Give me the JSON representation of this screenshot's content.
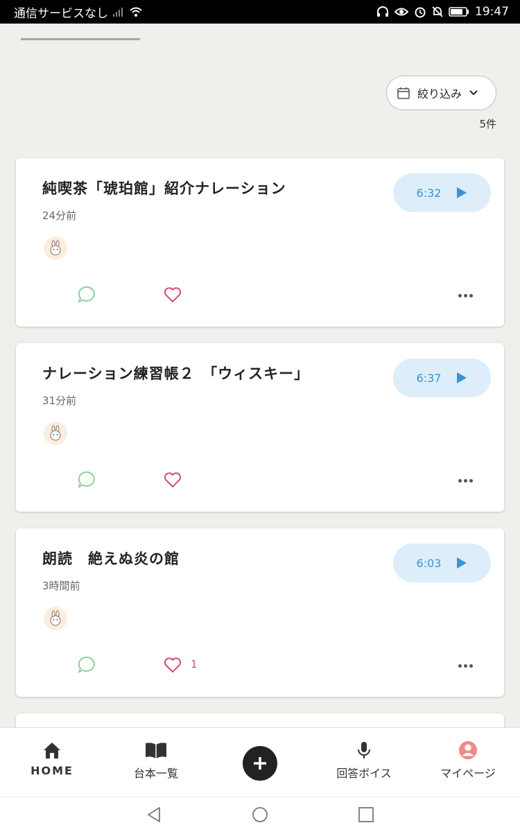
{
  "status": {
    "carrier": "通信サービスなし",
    "time": "19:47"
  },
  "filter": {
    "label": "絞り込み",
    "count": "5件"
  },
  "cards": [
    {
      "title": "純喫茶「琥珀館」紹介ナレーション",
      "time": "24分前",
      "duration": "6:32",
      "likes": ""
    },
    {
      "title": "ナレーション練習帳２　「ウィスキー」",
      "time": "31分前",
      "duration": "6:37",
      "likes": ""
    },
    {
      "title": "朗読　絶えぬ炎の館",
      "time": "3時間前",
      "duration": "6:03",
      "likes": "1"
    }
  ],
  "nav": {
    "home": "HOME",
    "scripts": "台本一覧",
    "voices": "回答ボイス",
    "mypage": "マイページ"
  },
  "colors": {
    "accent_blue": "#3a93d4",
    "play_bg": "#ddeefa",
    "comment_green": "#8fcf9a",
    "like_pink": "#d44b7a",
    "mypage_pink": "#ef8a8a"
  }
}
